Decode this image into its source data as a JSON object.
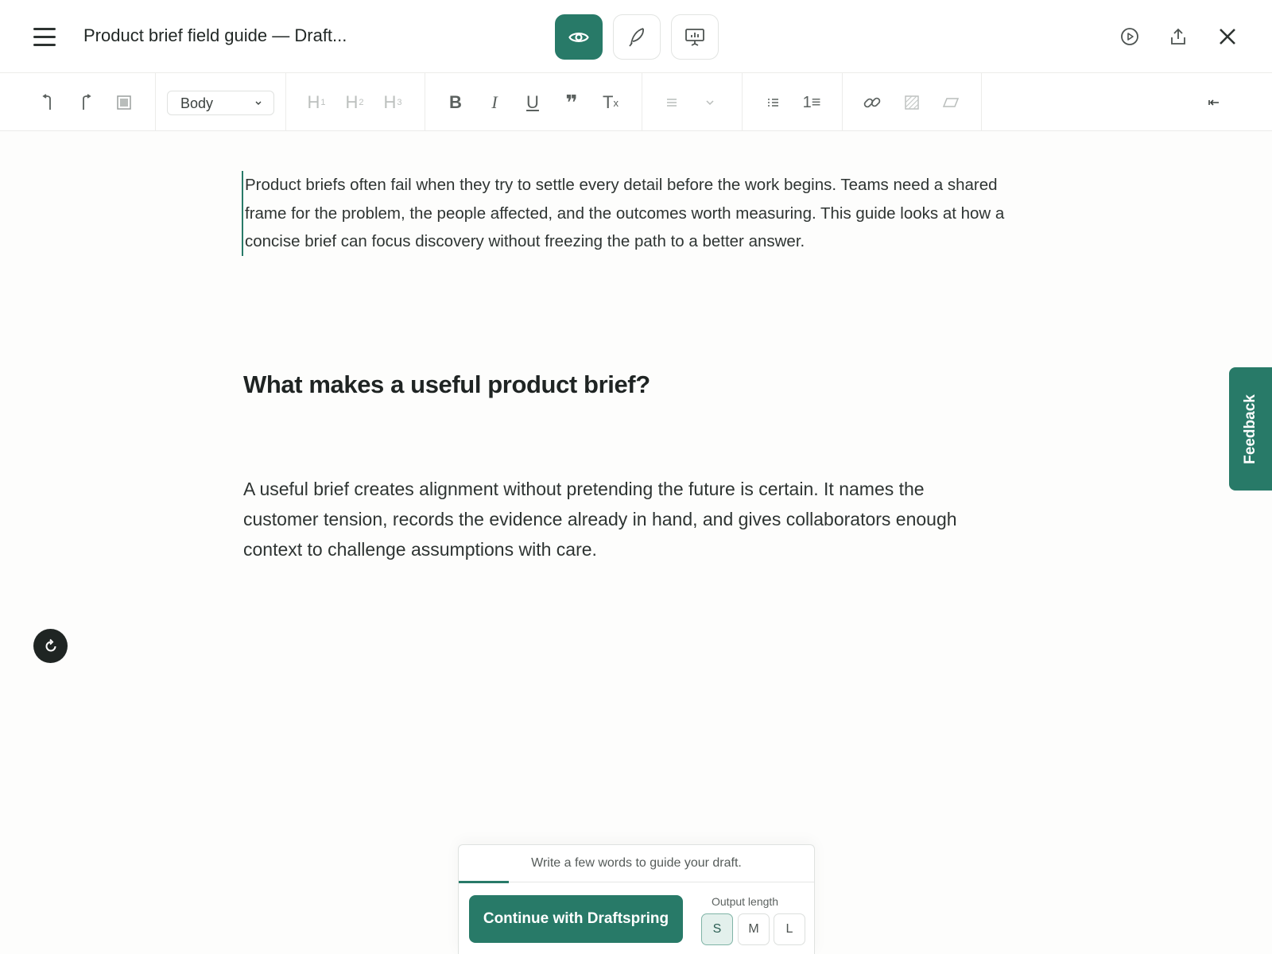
{
  "header": {
    "title": "Product brief field guide — Draft...",
    "modes": [
      {
        "name": "preview",
        "icon": "eye-icon",
        "active": true
      },
      {
        "name": "edit",
        "icon": "quill-icon",
        "active": false
      },
      {
        "name": "present",
        "icon": "presentation-icon",
        "active": false
      }
    ],
    "actions": [
      "play-circle-icon",
      "share-icon",
      "close-icon"
    ]
  },
  "toolbar": {
    "style_value": "Body",
    "headings": [
      "H",
      "H",
      "H"
    ],
    "heading_levels": [
      "1",
      "2",
      "3"
    ],
    "bold_label": "B",
    "italic_label": "I",
    "underline_label": "U",
    "quote_label": "❞",
    "clear_label": "T",
    "clear_sub": "x",
    "ordered_label": "1≡"
  },
  "document": {
    "intro": "Product briefs often fail when they try to settle every detail before the work begins. Teams need a shared frame for the problem, the people affected, and the outcomes worth measuring. This guide looks at how a concise brief can focus discovery without freezing the path to a better answer.",
    "heading": "What makes a useful product brief?",
    "body": "A useful brief creates alignment without pretending the future is certain. It names the customer tension, records the evidence already in hand, and gives collaborators enough context to challenge assumptions with care."
  },
  "feedback": {
    "label": "Feedback"
  },
  "draft_panel": {
    "placeholder": "Write a few words to guide your draft.",
    "continue_label": "Continue with Draftspring",
    "length_label": "Output length",
    "lengths": [
      "S",
      "M",
      "L"
    ],
    "selected_length": "S"
  },
  "colors": {
    "accent": "#287a68",
    "text": "#2e3432",
    "fab": "#1f2523"
  }
}
